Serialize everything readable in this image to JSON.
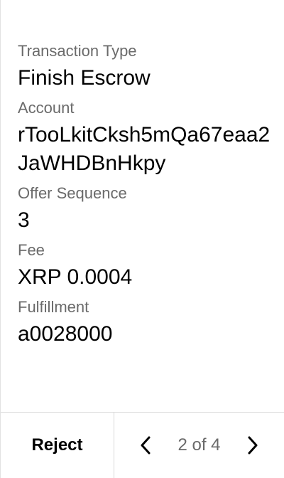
{
  "transaction": {
    "fields": [
      {
        "label": "Transaction Type",
        "value": "Finish Escrow"
      },
      {
        "label": "Account",
        "value": "rTooLkitCksh5mQa67eaa2JaWHDBnHkpy"
      },
      {
        "label": "Offer Sequence",
        "value": "3"
      },
      {
        "label": "Fee",
        "value": "XRP 0.0004"
      },
      {
        "label": "Fulfillment",
        "value": "a0028000"
      }
    ]
  },
  "footer": {
    "reject_label": "Reject",
    "pager_text": "2 of 4",
    "prev_icon": "chevron-left-icon",
    "next_icon": "chevron-right-icon"
  },
  "colors": {
    "label_gray": "#6a6a6a",
    "divider": "#d8d8d8"
  }
}
